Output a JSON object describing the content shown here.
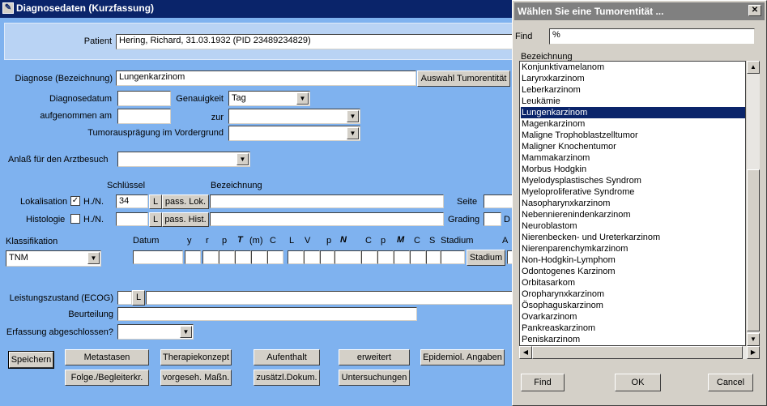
{
  "main_window": {
    "title": "Diagnosedaten (Kurzfassung)",
    "patient_label": "Patient",
    "patient_value": "Hering, Richard, 31.03.1932 (PID 23489234829)",
    "diagnose_label": "Diagnose (Bezeichnung)",
    "diagnose_value": "Lungenkarzinom",
    "auswahl_button": "Auswahl Tumorentität",
    "diagnosedatum_label": "Diagnosedatum",
    "genauigkeit_label": "Genauigkeit",
    "genauigkeit_value": "Tag",
    "aufgenommen_label": "aufgenommen am",
    "zur_label": "zur",
    "tumorauspraegung_label": "Tumorausprägung im Vordergrund",
    "anlass_label": "Anlaß für den Arztbesuch",
    "schluessel_header": "Schlüssel",
    "bezeichnung_header": "Bezeichnung",
    "lokalisation_label": "Lokalisation",
    "lokalisation_hn_checked": "✓",
    "hn_label": "H./N.",
    "lokalisation_key": "34",
    "l_button": "L",
    "pass_lok_button": "pass. Lok.",
    "seite_label": "Seite",
    "histologie_label": "Histologie",
    "pass_hist_button": "pass. Hist.",
    "grading_label": "Grading",
    "d_label": "D",
    "klassifikation_label": "Klassifikation",
    "klassifikation_value": "TNM",
    "tnm_headers": [
      "Datum",
      "y",
      "r",
      "p",
      "T",
      "(m)",
      "C",
      "L",
      "V",
      "p",
      "N",
      "C",
      "p",
      "M",
      "C",
      "S",
      "Stadium",
      "A"
    ],
    "stadium_button": "Stadium",
    "leistungszustand_label": "Leistungszustand (ECOG)",
    "beurteilung_label": "Beurteilung",
    "erfassung_label": "Erfassung abgeschlossen?",
    "buttons_row1": [
      "Speichern",
      "Metastasen",
      "Therapiekonzept",
      "Aufenthalt",
      "erweitert",
      "Epidemiol. Angaben"
    ],
    "buttons_row2": [
      "Folge./Begleiterkr.",
      "vorgeseh. Maßn.",
      "zusätzl.Dokum.",
      "Untersuchungen"
    ]
  },
  "dialog": {
    "title": "Wählen Sie eine Tumorentität ...",
    "close_icon": "close-icon",
    "find_label": "Find",
    "find_value": "%",
    "column_header": "Bezeichnung",
    "selected_index": 4,
    "items": [
      "Konjunktivamelanom",
      "Larynxkarzinom",
      "Leberkarzinom",
      "Leukämie",
      "Lungenkarzinom",
      "Magenkarzinom",
      "Maligne Trophoblastzelltumor",
      "Maligner Knochentumor",
      "Mammakarzinom",
      "Morbus Hodgkin",
      "Myelodysplastisches Syndrom",
      "Myeloproliferative Syndrome",
      "Nasopharynxkarzinom",
      "Nebennierenindenkarzinom",
      "Neuroblastom",
      "Nierenbecken- und Ureterkarzinom",
      "Nierenparenchymkarzinom",
      "Non-Hodgkin-Lymphom",
      "Odontogenes Karzinom",
      "Orbitasarkom",
      "Oropharynxkarzinom",
      "Ösophaguskarzinom",
      "Ovarkarzinom",
      "Pankreaskarzinom",
      "Peniskarzinom"
    ],
    "find_button": "Find",
    "ok_button": "OK",
    "cancel_button": "Cancel"
  },
  "colors": {
    "background": "#7fb2ef",
    "titlebar": "#0a246a",
    "inactive_titlebar": "#808080",
    "selection": "#0a246a"
  }
}
